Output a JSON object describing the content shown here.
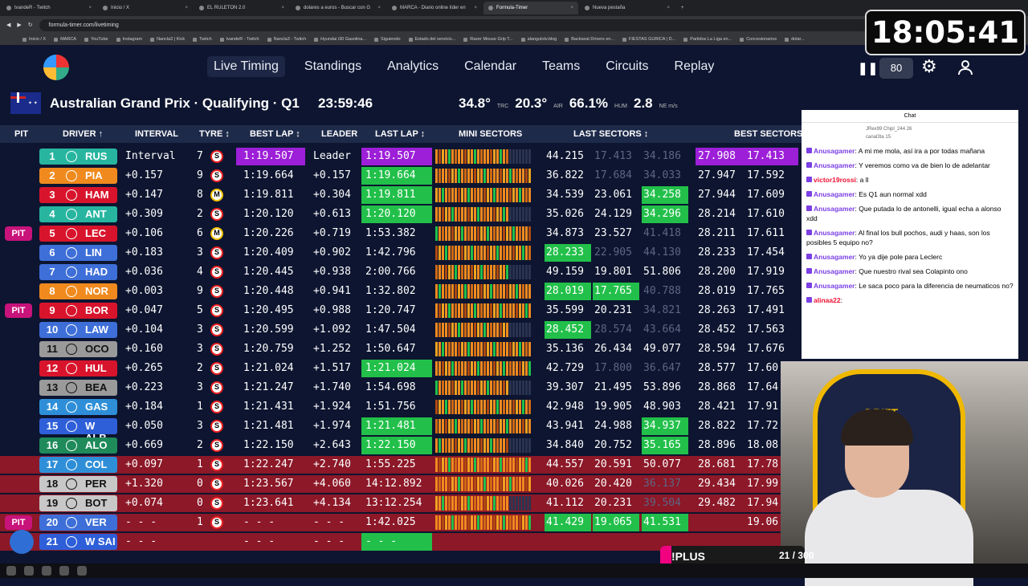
{
  "browser": {
    "tabs": [
      "tvandeR - Twitch",
      "Inicio / X",
      "EL RULETON 2.0",
      "dolares a euros - Buscar con G",
      "MARCA - Diario online líder en",
      "Formula-Timer",
      "Nueva pestaña"
    ],
    "active_tab": 5,
    "url": "formula-timer.com/livetiming",
    "bookmarks": [
      "Inicio / X",
      "MARCA",
      "YouTube",
      "Instagram",
      "Nancla3 | Kick",
      "Twitch",
      "tvandeR - Twitch",
      "Nancla3 - Twitch",
      "Hyundai i30 Gasolina...",
      "Siguiendo",
      "Estado del servicio...",
      "Razer Mouse Grip T...",
      "alangulotv.blog",
      "Backseat Drivers en...",
      "FIESTAS GURICA | D...",
      "Partidos La Liga en...",
      "Concesionarios",
      "dolar..."
    ]
  },
  "clock": "18:05:41",
  "nav": {
    "items": [
      "Live Timing",
      "Standings",
      "Analytics",
      "Calendar",
      "Teams",
      "Circuits",
      "Replay"
    ],
    "active": 0,
    "speed": "80"
  },
  "event": {
    "title": "Australian Grand Prix · Qualifying · Q1",
    "time_left": "23:59:46",
    "track_temp": "34.8°",
    "track_label": "TRC",
    "air_temp": "20.3°",
    "air_label": "AIR",
    "humidity": "66.1%",
    "hum_label": "HUM",
    "wind": "2.8",
    "wind_label": "NE m/s"
  },
  "table": {
    "headers": [
      "PIT",
      "DRIVER ↑",
      "INTERVAL",
      "TYRE ↕",
      "BEST LAP ↕",
      "LEADER",
      "LAST LAP ↕",
      "MINI SECTORS",
      "LAST SECTORS ↕",
      "BEST SECTORS"
    ],
    "rows": [
      {
        "pit": "",
        "pos": "1",
        "code": "RUS",
        "team": "#27b5a0",
        "interval": "Interval",
        "laps": "7",
        "tyre": "S",
        "best": "1:19.507",
        "best_hl": "purple",
        "leader": "Leader",
        "last": "1:19.507",
        "last_hl": "purple",
        "ls1": "44.215",
        "ls2": "17.413",
        "ls3": "34.186",
        "ls2dim": true,
        "ls3dim": true,
        "bs1": "27.908",
        "bs2": "17.413",
        "bs_hl": "purple",
        "out": false
      },
      {
        "pit": "",
        "pos": "2",
        "code": "PIA",
        "team": "#f08a1e",
        "interval": "+0.157",
        "laps": "9",
        "tyre": "S",
        "best": "1:19.664",
        "leader": "+0.157",
        "last": "1:19.664",
        "last_hl": "green",
        "ls1": "36.822",
        "ls2": "17.684",
        "ls3": "34.033",
        "ls2dim": true,
        "ls3dim": true,
        "bs1": "27.947",
        "bs2": "17.592",
        "out": false
      },
      {
        "pit": "",
        "pos": "3",
        "code": "HAM",
        "team": "#d8142c",
        "interval": "+0.147",
        "laps": "8",
        "tyre": "M",
        "best": "1:19.811",
        "leader": "+0.304",
        "last": "1:19.811",
        "last_hl": "green",
        "ls1": "34.539",
        "ls2": "23.061",
        "ls3": "34.258",
        "ls3green": true,
        "bs1": "27.944",
        "bs2": "17.609",
        "out": false
      },
      {
        "pit": "",
        "pos": "4",
        "code": "ANT",
        "team": "#27b5a0",
        "interval": "+0.309",
        "laps": "2",
        "tyre": "S",
        "best": "1:20.120",
        "leader": "+0.613",
        "last": "1:20.120",
        "last_hl": "green",
        "ls1": "35.026",
        "ls2": "24.129",
        "ls3": "34.296",
        "ls3green": true,
        "bs1": "28.214",
        "bs2": "17.610",
        "out": false
      },
      {
        "pit": "PIT",
        "pos": "5",
        "code": "LEC",
        "team": "#d8142c",
        "interval": "+0.106",
        "laps": "6",
        "tyre": "M",
        "best": "1:20.226",
        "leader": "+0.719",
        "last": "1:53.382",
        "ls1": "34.873",
        "ls2": "23.527",
        "ls3": "41.418",
        "ls3dim": true,
        "bs1": "28.211",
        "bs2": "17.611",
        "out": false
      },
      {
        "pit": "",
        "pos": "6",
        "code": "LIN",
        "team": "#3e6fd8",
        "interval": "+0.183",
        "laps": "3",
        "tyre": "S",
        "best": "1:20.409",
        "leader": "+0.902",
        "last": "1:42.796",
        "ls1": "28.233",
        "ls1green": true,
        "ls2": "22.905",
        "ls3": "44.130",
        "ls2dim": true,
        "ls3dim": true,
        "bs1": "28.233",
        "bs2": "17.454",
        "out": false
      },
      {
        "pit": "",
        "pos": "7",
        "code": "HAD",
        "team": "#3e6fd8",
        "interval": "+0.036",
        "laps": "4",
        "tyre": "S",
        "best": "1:20.445",
        "leader": "+0.938",
        "last": "2:00.766",
        "ls1": "49.159",
        "ls2": "19.801",
        "ls3": "51.806",
        "bs1": "28.200",
        "bs2": "17.919",
        "out": false
      },
      {
        "pit": "",
        "pos": "8",
        "code": "NOR",
        "team": "#f08a1e",
        "interval": "+0.003",
        "laps": "9",
        "tyre": "S",
        "best": "1:20.448",
        "leader": "+0.941",
        "last": "1:32.802",
        "ls1": "28.019",
        "ls1green": true,
        "ls2": "17.765",
        "ls2green": true,
        "ls3": "40.788",
        "ls3dim": true,
        "bs1": "28.019",
        "bs2": "17.765",
        "out": false
      },
      {
        "pit": "PIT",
        "pos": "9",
        "code": "BOR",
        "team": "#d8142c",
        "interval": "+0.047",
        "laps": "5",
        "tyre": "S",
        "best": "1:20.495",
        "leader": "+0.988",
        "last": "1:20.747",
        "ls1": "35.599",
        "ls2": "20.231",
        "ls3": "34.821",
        "ls3dim": true,
        "bs1": "28.263",
        "bs2": "17.491",
        "out": false
      },
      {
        "pit": "",
        "pos": "10",
        "code": "LAW",
        "team": "#3e6fd8",
        "interval": "+0.104",
        "laps": "3",
        "tyre": "S",
        "best": "1:20.599",
        "leader": "+1.092",
        "last": "1:47.504",
        "ls1": "28.452",
        "ls1green": true,
        "ls2": "28.574",
        "ls3": "43.664",
        "ls2dim": true,
        "ls3dim": true,
        "bs1": "28.452",
        "bs2": "17.563",
        "out": false
      },
      {
        "pit": "",
        "pos": "11",
        "code": "OCO",
        "team": "#9a9a9a",
        "interval": "+0.160",
        "laps": "3",
        "tyre": "S",
        "best": "1:20.759",
        "leader": "+1.252",
        "last": "1:50.647",
        "ls1": "35.136",
        "ls2": "26.434",
        "ls3": "49.077",
        "bs1": "28.594",
        "bs2": "17.676",
        "out": false
      },
      {
        "pit": "",
        "pos": "12",
        "code": "HUL",
        "team": "#d8142c",
        "interval": "+0.265",
        "laps": "2",
        "tyre": "S",
        "best": "1:21.024",
        "leader": "+1.517",
        "last": "1:21.024",
        "last_hl": "green",
        "ls1": "42.729",
        "ls2": "17.800",
        "ls3": "36.647",
        "ls2dim": true,
        "ls3dim": true,
        "bs1": "28.577",
        "bs2": "17.60",
        "out": false
      },
      {
        "pit": "",
        "pos": "13",
        "code": "BEA",
        "team": "#9a9a9a",
        "interval": "+0.223",
        "laps": "3",
        "tyre": "S",
        "best": "1:21.247",
        "leader": "+1.740",
        "last": "1:54.698",
        "ls1": "39.307",
        "ls2": "21.495",
        "ls3": "53.896",
        "bs1": "28.868",
        "bs2": "17.64",
        "out": false
      },
      {
        "pit": "",
        "pos": "14",
        "code": "GAS",
        "team": "#2e8fd8",
        "interval": "+0.184",
        "laps": "1",
        "tyre": "S",
        "best": "1:21.431",
        "leader": "+1.924",
        "last": "1:51.756",
        "ls1": "42.948",
        "ls2": "19.905",
        "ls3": "48.903",
        "bs1": "28.421",
        "bs2": "17.91",
        "out": false
      },
      {
        "pit": "",
        "pos": "15",
        "code": "W ALB",
        "team": "#2e5fd8",
        "interval": "+0.050",
        "laps": "3",
        "tyre": "S",
        "best": "1:21.481",
        "leader": "+1.974",
        "last": "1:21.481",
        "last_hl": "green",
        "ls1": "43.941",
        "ls2": "24.988",
        "ls3": "34.937",
        "ls3green": true,
        "bs1": "28.822",
        "bs2": "17.72",
        "out": false
      },
      {
        "pit": "",
        "pos": "16",
        "code": "ALO",
        "team": "#1f8a5a",
        "interval": "+0.669",
        "laps": "2",
        "tyre": "S",
        "best": "1:22.150",
        "leader": "+2.643",
        "last": "1:22.150",
        "last_hl": "green",
        "ls1": "34.840",
        "ls2": "20.752",
        "ls3": "35.165",
        "ls3green": true,
        "bs1": "28.896",
        "bs2": "18.08",
        "out": false
      },
      {
        "pit": "",
        "pos": "17",
        "code": "COL",
        "team": "#2e8fd8",
        "interval": "+0.097",
        "laps": "1",
        "tyre": "S",
        "best": "1:22.247",
        "leader": "+2.740",
        "last": "1:55.225",
        "ls1": "44.557",
        "ls2": "20.591",
        "ls3": "50.077",
        "bs1": "28.681",
        "bs2": "17.78",
        "out": true
      },
      {
        "pit": "",
        "pos": "18",
        "code": "PER",
        "team": "#c8c8c8",
        "interval": "+1.320",
        "laps": "0",
        "tyre": "S",
        "best": "1:23.567",
        "leader": "+4.060",
        "last": "14:12.892",
        "ls1": "40.026",
        "ls2": "20.420",
        "ls3": "36.137",
        "ls3dim": true,
        "bs1": "29.434",
        "bs2": "17.99",
        "out": true
      },
      {
        "pit": "",
        "pos": "19",
        "code": "BOT",
        "team": "#c8c8c8",
        "interval": "+0.074",
        "laps": "0",
        "tyre": "S",
        "best": "1:23.641",
        "leader": "+4.134",
        "last": "13:12.254",
        "ls1": "41.112",
        "ls2": "20.231",
        "ls3": "39.504",
        "ls3dim": true,
        "bs1": "29.482",
        "bs2": "17.94",
        "out": true
      },
      {
        "pit": "PIT",
        "pos": "20",
        "code": "VER",
        "team": "#3e6fd8",
        "interval": "- - -",
        "laps": "1",
        "tyre": "S",
        "best": "- - -",
        "leader": "- - -",
        "last": "1:42.025",
        "ls1": "41.429",
        "ls1green": true,
        "ls2": "19.065",
        "ls2green": true,
        "ls3": "41.531",
        "ls3green": true,
        "bs1": "",
        "bs2": "19.06",
        "out": true
      },
      {
        "pit": "",
        "pos": "21",
        "code": "W SAI",
        "team": "#2e5fd8",
        "interval": "- - -",
        "laps": "",
        "tyre": "",
        "best": "- - -",
        "leader": "- - -",
        "last": "- - -",
        "last_hl": "green",
        "ls1": "",
        "ls2": "",
        "ls3": "",
        "bs1": "",
        "bs2": "",
        "out": true
      }
    ]
  },
  "chat": {
    "title": "Chat",
    "gifts": [
      "JRex99  Chipl_244  26",
      "canal3ta  15"
    ],
    "messages": [
      {
        "user": "Anusagamer",
        "text": "A mi me mola, así ira a por todas mañana"
      },
      {
        "user": "Anusagamer",
        "text": "Y veremos como va de bien lo de adelantar"
      },
      {
        "user": "victor19rossi",
        "text": "a ll",
        "red": true
      },
      {
        "user": "Anusagamer",
        "text": "Es Q1 aun normal xdd"
      },
      {
        "user": "Anusagamer",
        "text": "Que putada lo de antonelli, igual echa a alonso xdd"
      },
      {
        "user": "Anusagamer",
        "text": "Al final los bull pochos, audi y haas, son los posibles 5 equipo no?"
      },
      {
        "user": "Anusagamer",
        "text": "Yo ya dije pole para Leclerc"
      },
      {
        "user": "Anusagamer",
        "text": "Que nuestro rival sea Colapinto ono"
      },
      {
        "user": "Anusagamer",
        "text": "Le saca poco para la diferencia de neumaticos no?"
      },
      {
        "user": "alinaa22",
        "text": "",
        "red": true
      }
    ]
  },
  "overlay": {
    "webcam_brand": "DRIFT",
    "command": "!PLUS",
    "counter": "21 / 300"
  }
}
